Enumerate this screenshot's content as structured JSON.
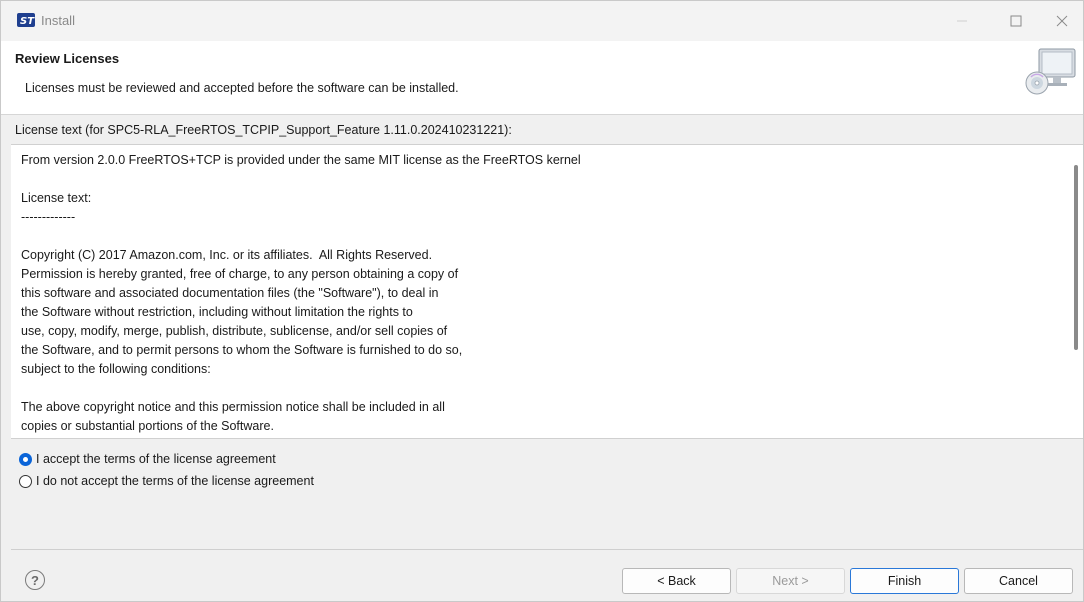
{
  "window": {
    "title": "Install",
    "controls": [
      "minimize-icon",
      "maximize-icon",
      "close-icon"
    ]
  },
  "banner": {
    "title": "Review Licenses",
    "description": "Licenses must be reviewed and accepted before the software can be installed."
  },
  "license": {
    "label": "License text (for SPC5-RLA_FreeRTOS_TCPIP_Support_Feature 1.11.0.202410231221):",
    "text": "From version 2.0.0 FreeRTOS+TCP is provided under the same MIT license as the FreeRTOS kernel\n\nLicense text:\n-------------\n\nCopyright (C) 2017 Amazon.com, Inc. or its affiliates.  All Rights Reserved.\nPermission is hereby granted, free of charge, to any person obtaining a copy of\nthis software and associated documentation files (the \"Software\"), to deal in\nthe Software without restriction, including without limitation the rights to\nuse, copy, modify, merge, publish, distribute, sublicense, and/or sell copies of\nthe Software, and to permit persons to whom the Software is furnished to do so,\nsubject to the following conditions:\n\nThe above copyright notice and this permission notice shall be included in all\ncopies or substantial portions of the Software."
  },
  "options": {
    "accept": "I accept the terms of the license agreement",
    "decline": "I do not accept the terms of the license agreement",
    "selected": "accept"
  },
  "buttons": {
    "help": "?",
    "back": "< Back",
    "next": "Next >",
    "finish": "Finish",
    "cancel": "Cancel"
  },
  "colors": {
    "accent": "#0a64d8",
    "finish_border": "#2a78d8"
  }
}
